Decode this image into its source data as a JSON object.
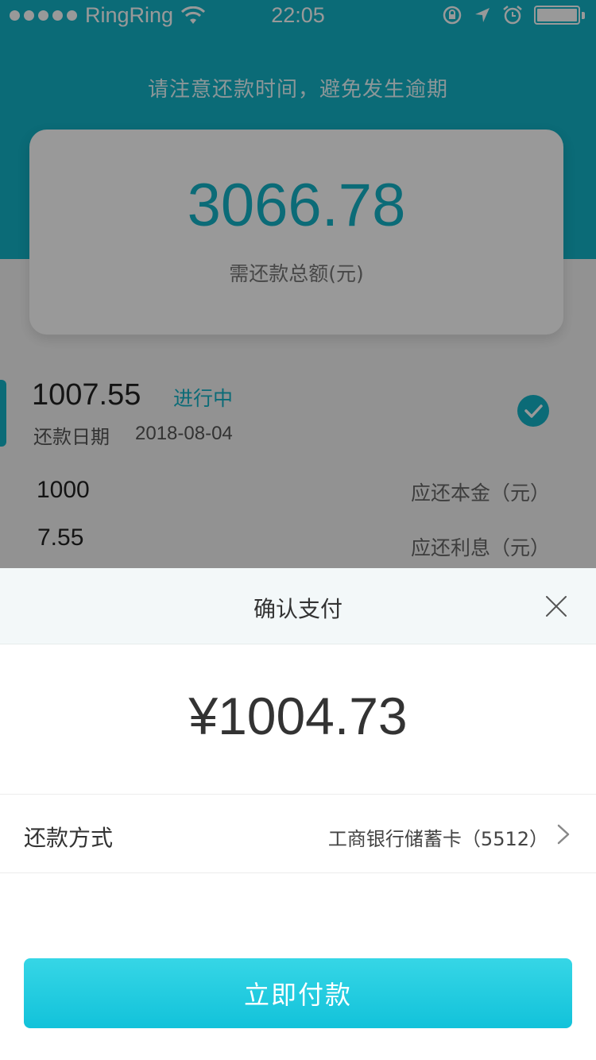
{
  "status_bar": {
    "carrier": "RingRing",
    "time": "22:05"
  },
  "background": {
    "notice": "请注意还款时间，避免发生逾期",
    "total_amount": "3066.78",
    "total_label": "需还款总额(元)",
    "bill": {
      "amount": "1007.55",
      "status": "进行中",
      "date_label": "还款日期",
      "date": "2018-08-04",
      "principal_value": "1000",
      "principal_label": "应还本金（元）",
      "interest_value": "7.55",
      "interest_label": "应还利息（元）"
    }
  },
  "payment_sheet": {
    "title": "确认支付",
    "amount": "¥1004.73",
    "method_label": "还款方式",
    "method_value": "工商银行储蓄卡（5512）",
    "pay_button_label": "立即付款"
  },
  "colors": {
    "accent": "#13b2c6",
    "button_gradient_top": "#36d6e6",
    "button_gradient_bottom": "#12c2da",
    "sheet_header_bg": "#f3f8f9"
  },
  "icons": [
    "wifi-icon",
    "rotation-lock-icon",
    "location-icon",
    "alarm-icon",
    "battery-icon",
    "check-icon",
    "close-icon",
    "chevron-right-icon"
  ]
}
